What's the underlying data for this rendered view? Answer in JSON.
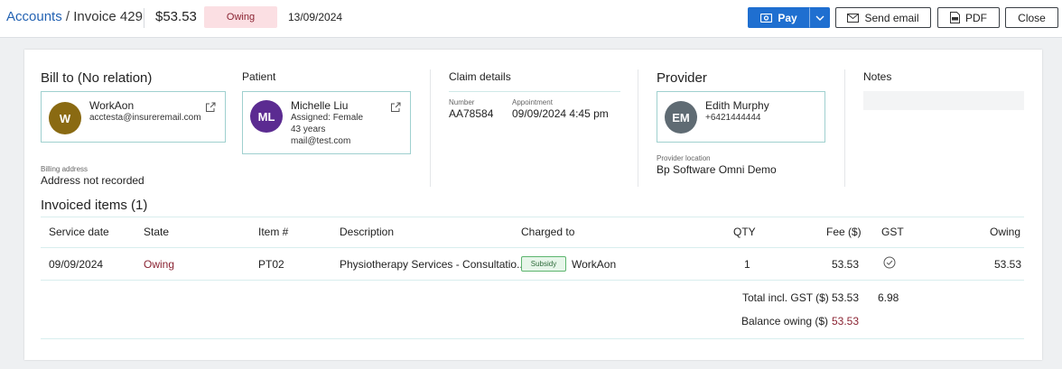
{
  "header": {
    "breadcrumb_root": "Accounts",
    "breadcrumb_sep": "/",
    "breadcrumb_current": "Invoice 429",
    "amount": "$53.53",
    "status": "Owing",
    "date": "13/09/2024",
    "pay_label": "Pay",
    "send_email_label": "Send email",
    "pdf_label": "PDF",
    "close_label": "Close"
  },
  "bill_to": {
    "title": "Bill to (No relation)",
    "initial": "W",
    "name": "WorkAon",
    "email": "acctesta@insureremail.com",
    "billing_address_label": "Billing address",
    "billing_address": "Address not recorded"
  },
  "patient": {
    "title": "Patient",
    "initials": "ML",
    "name": "Michelle Liu",
    "assigned": "Assigned: Female",
    "age": "43 years",
    "email": "mail@test.com"
  },
  "claim": {
    "title": "Claim details",
    "number_label": "Number",
    "number": "AA78584",
    "appointment_label": "Appointment",
    "appointment": "09/09/2024 4:45 pm"
  },
  "provider": {
    "title": "Provider",
    "initials": "EM",
    "name": "Edith Murphy",
    "phone": "+6421444444",
    "location_label": "Provider location",
    "location": "Bp Software Omni Demo"
  },
  "notes": {
    "title": "Notes"
  },
  "items": {
    "title": "Invoiced items (1)",
    "columns": [
      "Service date",
      "State",
      "Item #",
      "Description",
      "Charged to",
      "QTY",
      "Fee ($)",
      "GST",
      "Owing"
    ],
    "rows": [
      {
        "service_date": "09/09/2024",
        "state": "Owing",
        "item": "PT02",
        "description": "Physiotherapy Services - Consultatio...",
        "charged_badge": "Subsidy",
        "charged_to": "WorkAon",
        "qty": "1",
        "fee": "53.53",
        "owing": "53.53"
      }
    ],
    "total_label": "Total incl. GST ($)",
    "total_fee": "53.53",
    "total_gst": "6.98",
    "balance_label": "Balance owing ($)",
    "balance": "53.53"
  },
  "colors": {
    "primary": "#1f6fd0",
    "owing": "#8a2332",
    "bill_avatar": "#8a6a12",
    "patient_avatar": "#5b2b91",
    "provider_avatar": "#5f6b73"
  }
}
